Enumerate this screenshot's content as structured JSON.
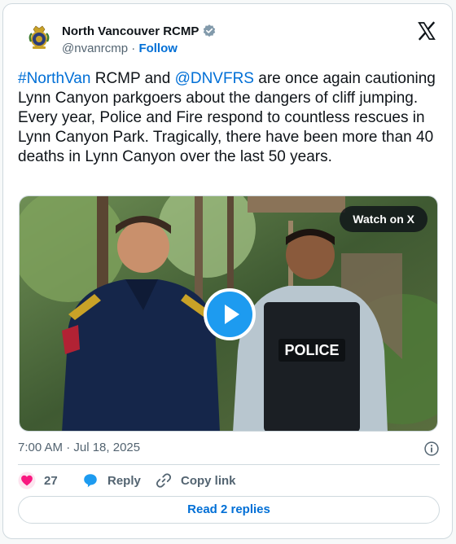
{
  "author": {
    "name": "North Vancouver RCMP",
    "handle": "@nvanrcmp",
    "separator": "·",
    "follow_label": "Follow"
  },
  "tweet": {
    "segments": [
      {
        "text": "#NorthVan",
        "link": true
      },
      {
        "text": " RCMP and ",
        "link": false
      },
      {
        "text": "@DNVFRS",
        "link": true
      },
      {
        "text": " are once again cautioning Lynn Canyon parkgoers about the dangers of cliff jumping. Every year, Police and Fire respond to countless rescues in Lynn Canyon Park. Tragically, there have been more than 40 deaths in Lynn Canyon over the last 50 years.",
        "link": false
      }
    ]
  },
  "media": {
    "watch_label": "Watch on X",
    "vest_text": "POLICE"
  },
  "meta": {
    "timestamp": "7:00 AM · Jul 18, 2025"
  },
  "actions": {
    "like_count": "27",
    "reply_label": "Reply",
    "copy_label": "Copy link"
  },
  "read_replies_label": "Read 2 replies",
  "colors": {
    "link": "#006fd6",
    "like": "#f91880",
    "reply": "#1d9bf0",
    "play": "#1d9bf0",
    "border": "#cfd9de",
    "muted": "#536471"
  },
  "icons": [
    "rcmp-crest-icon",
    "verified-badge-icon",
    "x-logo-icon",
    "play-icon",
    "info-icon",
    "heart-icon",
    "reply-bubble-icon",
    "link-icon"
  ]
}
